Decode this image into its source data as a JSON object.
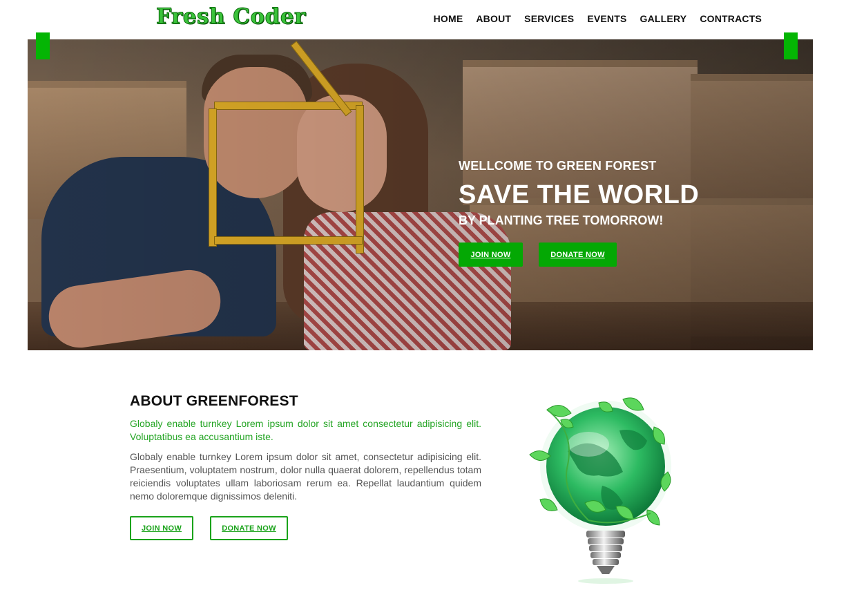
{
  "header": {
    "logo": "Fresh Coder",
    "nav": [
      "HOME",
      "ABOUT",
      "SERVICES",
      "EVENTS",
      "GALLERY",
      "CONTRACTS"
    ]
  },
  "hero": {
    "welcome": "WELLCOME TO GREEN FOREST",
    "headline": "SAVE THE WORLD",
    "subline": "BY PLANTING TREE TOMORROW!",
    "join_label": "JOIN NOW",
    "donate_label": "DONATE NOW"
  },
  "about": {
    "title": "ABOUT GREENFOREST",
    "lead": "Globaly enable turnkey Lorem ipsum dolor sit amet consectetur adipisicing elit. Voluptatibus ea accusantium iste.",
    "body": "Globaly enable turnkey Lorem ipsum dolor sit amet, consectetur adipisicing elit. Praesentium, voluptatem nostrum, dolor nulla quaerat dolorem, repellendus totam reiciendis voluptates ullam laboriosam rerum ea. Repellat laudantium quidem nemo doloremque dignissimos deleniti.",
    "join_label": "JOIN NOW",
    "donate_label": "DONATE NOW"
  },
  "colors": {
    "accent": "#04a804",
    "logo": "#3ac23a",
    "lead_text": "#23a423"
  },
  "icons": {
    "hero_image": "couple-with-ruler-house-photo",
    "about_image": "green-earth-lightbulb-icon"
  }
}
